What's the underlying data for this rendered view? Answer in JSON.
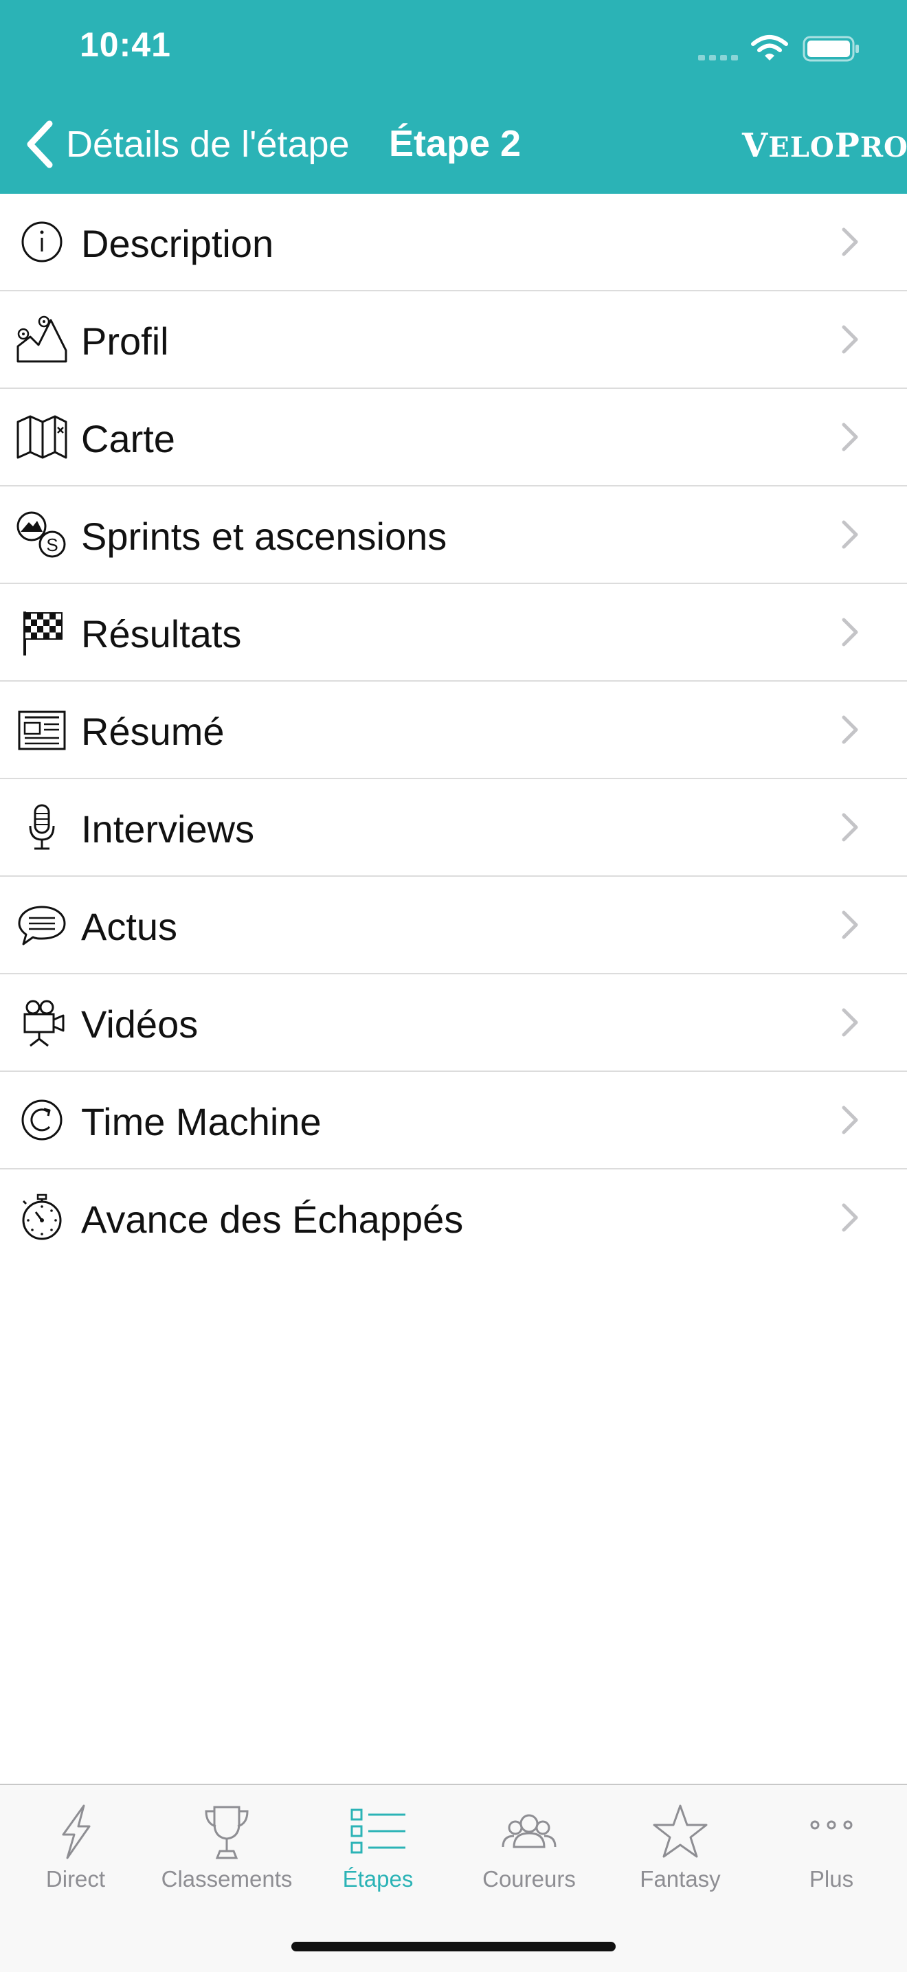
{
  "status_bar": {
    "time": "10:41"
  },
  "nav": {
    "back_label": "Détails de l'étape",
    "title": "Étape 2",
    "brand_first": "V",
    "brand_rest1": "ELO",
    "brand_second": "P",
    "brand_rest2": "RO"
  },
  "menu": {
    "items": [
      {
        "label": "Description",
        "icon": "info-icon"
      },
      {
        "label": "Profil",
        "icon": "profile-map-icon"
      },
      {
        "label": "Carte",
        "icon": "map-icon"
      },
      {
        "label": "Sprints et ascensions",
        "icon": "sprints-climbs-icon"
      },
      {
        "label": "Résultats",
        "icon": "checkered-flag-icon"
      },
      {
        "label": "Résumé",
        "icon": "newspaper-icon"
      },
      {
        "label": "Interviews",
        "icon": "microphone-icon"
      },
      {
        "label": "Actus",
        "icon": "speech-bubble-icon"
      },
      {
        "label": "Vidéos",
        "icon": "video-camera-icon"
      },
      {
        "label": "Time Machine",
        "icon": "refresh-icon"
      },
      {
        "label": "Avance des Échappés",
        "icon": "stopwatch-icon"
      }
    ]
  },
  "tabbar": {
    "tabs": [
      {
        "label": "Direct",
        "icon": "lightning-icon",
        "active": false
      },
      {
        "label": "Classements",
        "icon": "trophy-icon",
        "active": false
      },
      {
        "label": "Étapes",
        "icon": "list-icon",
        "active": true
      },
      {
        "label": "Coureurs",
        "icon": "people-icon",
        "active": false
      },
      {
        "label": "Fantasy",
        "icon": "star-icon",
        "active": false
      },
      {
        "label": "Plus",
        "icon": "more-icon",
        "active": false
      }
    ]
  },
  "colors": {
    "accent": "#2bb3b6",
    "inactive": "#8e8e93",
    "chevron": "#c4c4c7"
  }
}
